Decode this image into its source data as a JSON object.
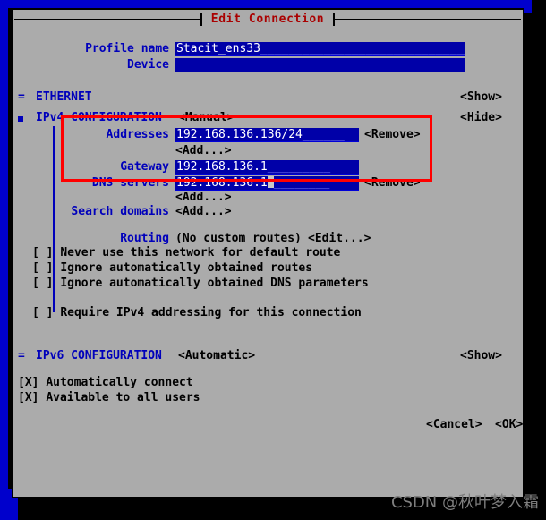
{
  "window": {
    "title": "Edit Connection"
  },
  "colors": {
    "frame_blue": "#0000cc",
    "panel_gray": "#ababab",
    "title_red": "#aa0000",
    "label_blue": "#0000bb",
    "field_blue": "#0000a8",
    "annotation_red": "#ff0000",
    "text_black": "#000000"
  },
  "profile": {
    "name_label": "Profile name",
    "name_value": "Stacit_ens33",
    "name_pad": "______________________________",
    "device_label": "Device",
    "device_value": "",
    "device_pad": ""
  },
  "sections": {
    "ethernet": {
      "marker": "=",
      "label": "ETHERNET",
      "toggle": "<Show>"
    },
    "ipv4": {
      "marker": "square",
      "label": "IPv4 CONFIGURATION",
      "mode": "<Manual>",
      "toggle": "<Hide>",
      "addresses_label": "Addresses",
      "addresses_value": "192.168.136.136/24",
      "addresses_pad": "______",
      "addresses_remove": "<Remove>",
      "addresses_add": "<Add...>",
      "gateway_label": "Gateway",
      "gateway_value": "192.168.136.1",
      "gateway_pad": "_________",
      "dns_label": "DNS servers",
      "dns_value": "192.168.136.1",
      "dns_pad": "________",
      "dns_remove": "<Remove>",
      "dns_add": "<Add...>",
      "search_label": "Search domains",
      "search_add": "<Add...>",
      "routing_label": "Routing",
      "routing_value": "(No custom routes)",
      "routing_edit": "<Edit...>",
      "checkboxes": [
        {
          "box": "[ ]",
          "label": "Never use this network for default route"
        },
        {
          "box": "[ ]",
          "label": "Ignore automatically obtained routes"
        },
        {
          "box": "[ ]",
          "label": "Ignore automatically obtained DNS parameters"
        },
        {
          "box": "[ ]",
          "label": "Require IPv4 addressing for this connection"
        }
      ]
    },
    "ipv6": {
      "marker": "=",
      "label": "IPv6 CONFIGURATION",
      "mode": "<Automatic>",
      "toggle": "<Show>"
    }
  },
  "options": [
    {
      "box": "[X]",
      "label": "Automatically connect"
    },
    {
      "box": "[X]",
      "label": "Available to all users"
    }
  ],
  "buttons": {
    "cancel": "<Cancel>",
    "ok": "<OK>"
  },
  "watermark": {
    "text": "CSDN @秋叶梦入霜"
  }
}
